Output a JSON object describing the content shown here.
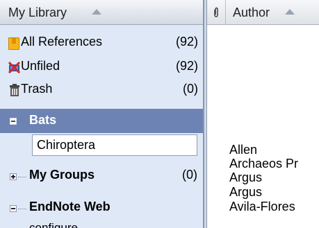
{
  "library": {
    "header_title": "My Library",
    "items": [
      {
        "label": "All References",
        "count": "(92)",
        "icon": "all-references-icon"
      },
      {
        "label": "Unfiled",
        "count": "(92)",
        "icon": "unfiled-icon"
      },
      {
        "label": "Trash",
        "count": "(0)",
        "icon": "trash-icon"
      }
    ],
    "group_set": {
      "label": "Bats",
      "editing_value": "Chiroptera"
    },
    "my_groups": {
      "label": "My Groups",
      "count": "(0)"
    },
    "endnote_web": {
      "label": "EndNote Web",
      "sub_item": "configure"
    }
  },
  "references": {
    "column_author": "Author",
    "authors": [
      "Allen",
      "Archaeos Pr",
      "Argus",
      "Argus",
      "Avila-Flores"
    ]
  },
  "colors": {
    "panel_bg": "#dfe8f6",
    "selected_group_bg": "#6d83b3",
    "icon_yellow": "#f6b619",
    "unfiled_red": "#d0262a",
    "unfiled_blue": "#2557b3"
  }
}
